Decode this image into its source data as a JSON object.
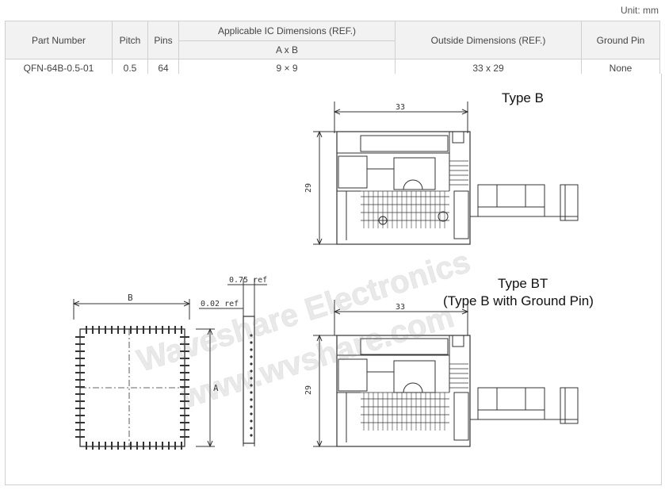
{
  "unit_label": "Unit: mm",
  "table": {
    "headers": {
      "part_number": "Part Number",
      "pitch": "Pitch",
      "pins": "Pins",
      "ic_dimensions": "Applicable IC Dimensions (REF.)",
      "ic_sub": "A x B",
      "outside_dimensions": "Outside Dimensions (REF.)",
      "ground_pin": "Ground Pin"
    },
    "row": {
      "part_number": "QFN-64B-0.5-01",
      "pitch": "0.5",
      "pins": "64",
      "ic_dimensions": "9 × 9",
      "outside_dimensions": "33 x 29",
      "ground_pin": "None"
    }
  },
  "drawing": {
    "ic_label_b": "B",
    "ic_label_a": "A",
    "side_label_075": "0.75 ref",
    "side_label_002": "0.02 ref",
    "type_b_title": "Type B",
    "type_bt_title": "Type BT",
    "type_bt_subtitle": "(Type B with Ground Pin)",
    "dim_width_b": "33",
    "dim_height_b": "29",
    "dim_width_bt": "33",
    "dim_height_bt": "29",
    "watermark_1": "Waveshare Electronics",
    "watermark_2": "www.wvshare.com"
  }
}
